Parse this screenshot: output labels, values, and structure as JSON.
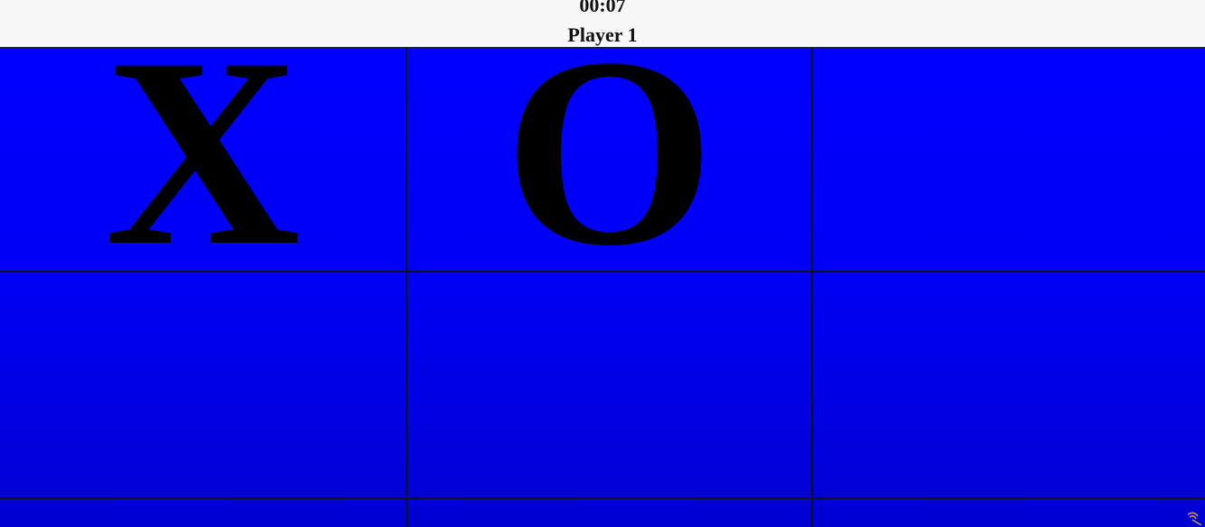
{
  "header": {
    "timer": "00:07",
    "player": "Player 1"
  },
  "board": {
    "cells": [
      "X",
      "O",
      "",
      "",
      "",
      "",
      "",
      "",
      ""
    ]
  },
  "colors": {
    "board_top": "#0000ff",
    "board_bottom": "#0000d2",
    "grid_line": "#111111",
    "mark": "#000000"
  },
  "icons": {
    "corner": "resize-grip-icon"
  }
}
